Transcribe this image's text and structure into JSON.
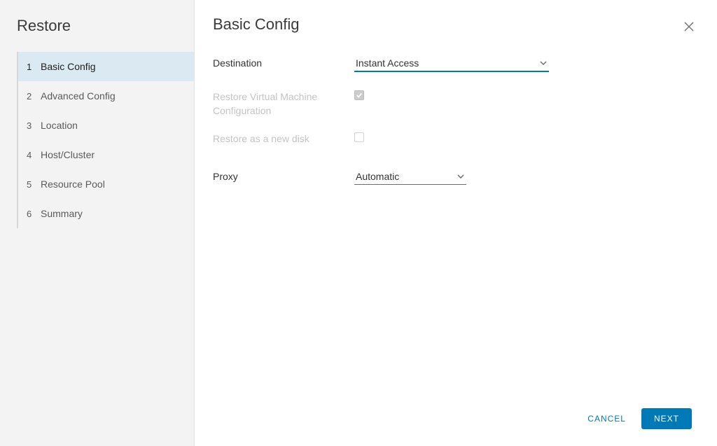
{
  "sidebar": {
    "title": "Restore",
    "steps": [
      {
        "num": "1",
        "label": "Basic Config",
        "active": true
      },
      {
        "num": "2",
        "label": "Advanced Config",
        "active": false
      },
      {
        "num": "3",
        "label": "Location",
        "active": false
      },
      {
        "num": "4",
        "label": "Host/Cluster",
        "active": false
      },
      {
        "num": "5",
        "label": "Resource Pool",
        "active": false
      },
      {
        "num": "6",
        "label": "Summary",
        "active": false
      }
    ]
  },
  "panel": {
    "title": "Basic Config"
  },
  "form": {
    "destination": {
      "label": "Destination",
      "value": "Instant Access"
    },
    "restore_vm_config": {
      "label": "Restore Virtual Machine Configuration",
      "checked": true,
      "disabled": true
    },
    "restore_new_disk": {
      "label": "Restore as a new disk",
      "checked": false,
      "disabled": true
    },
    "proxy": {
      "label": "Proxy",
      "value": "Automatic"
    }
  },
  "footer": {
    "cancel": "CANCEL",
    "next": "NEXT"
  }
}
